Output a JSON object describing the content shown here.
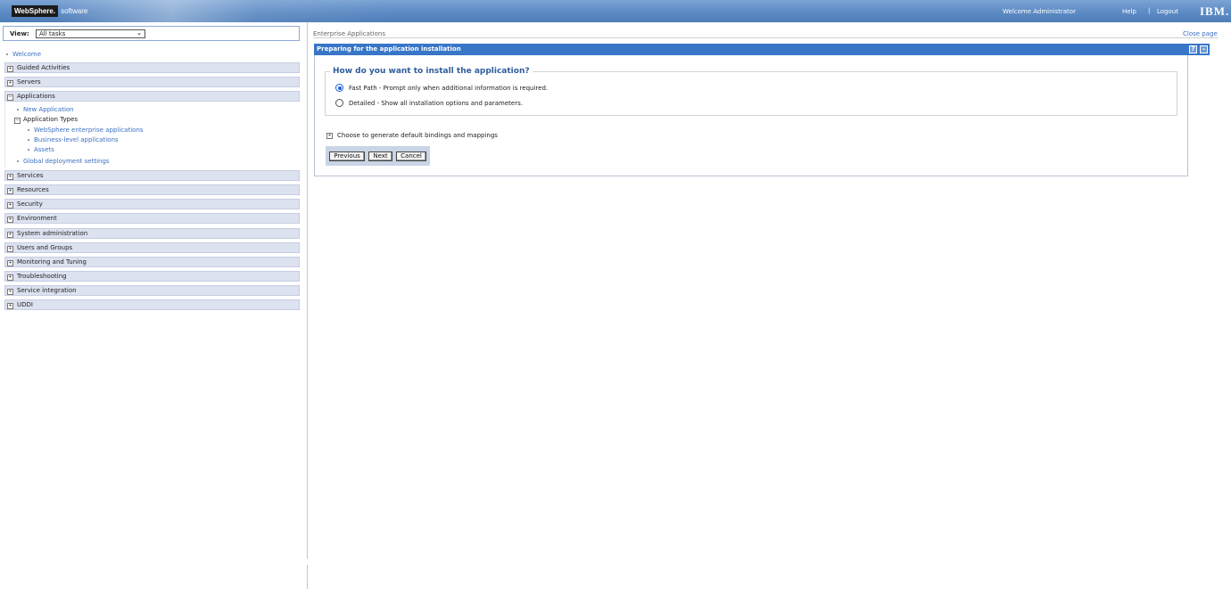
{
  "banner": {
    "brand": "WebSphere.",
    "product": "software",
    "welcome": "Welcome Administrator",
    "help": "Help",
    "separator": "|",
    "logout": "Logout",
    "ibm": "IBM."
  },
  "nav": {
    "view_label": "View:",
    "view_value": "All tasks",
    "welcome": "Welcome",
    "categories": [
      "Guided Activities",
      "Servers",
      "Applications",
      "Services",
      "Resources",
      "Security",
      "Environment",
      "System administration",
      "Users and Groups",
      "Monitoring and Tuning",
      "Troubleshooting",
      "Service integration",
      "UDDI"
    ],
    "applications": {
      "new_application": "New Application",
      "application_types": "Application Types",
      "websphere_enterprise": "WebSphere enterprise applications",
      "business_level": "Business-level applications",
      "assets": "Assets",
      "global_deployment": "Global deployment settings"
    }
  },
  "content": {
    "breadcrumb": "Enterprise Applications",
    "close_page": "Close page",
    "panel_title": "Preparing for the application installation",
    "help_btn": "?",
    "minimize_btn": "–",
    "question": "How do you want to install the application?",
    "fast_path": "Fast Path - Prompt only when additional information is required.",
    "detailed": "Detailed - Show all installation options and parameters.",
    "bindings_toggle": "Choose to generate default bindings and mappings",
    "buttons": {
      "previous": "Previous",
      "next": "Next",
      "cancel": "Cancel"
    }
  },
  "icons": {
    "expand": "+",
    "collapse": "−",
    "chevron": "⌄"
  },
  "colors": {
    "banner": "#5d8bc4",
    "titlebar": "#3876c7",
    "link": "#3b6fc0",
    "category_bg": "#dde2f0"
  }
}
